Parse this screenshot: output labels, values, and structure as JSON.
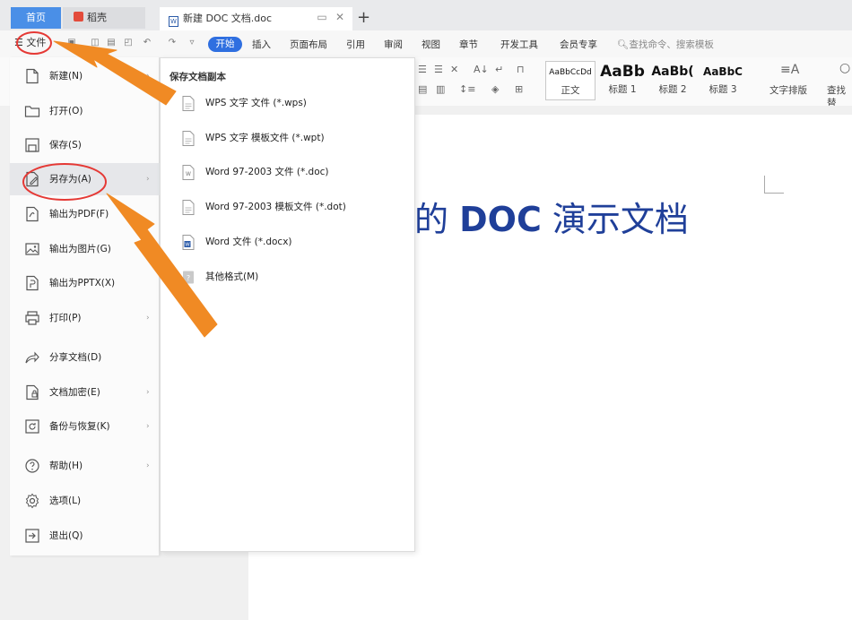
{
  "tabs": {
    "home": "首页",
    "docer": "稻壳",
    "document": "新建 DOC 文档.doc"
  },
  "ribbon": {
    "file_menu": "文件",
    "tabs": [
      "开始",
      "插入",
      "页面布局",
      "引用",
      "审阅",
      "视图",
      "章节",
      "开发工具",
      "会员专享"
    ],
    "search_placeholder": "查找命令、搜索模板"
  },
  "styles": {
    "previews": [
      "AaBbCcDd",
      "AaBb",
      "AaBb(",
      "AaBbC"
    ],
    "names": [
      "正文",
      "标题 1",
      "标题 2",
      "标题 3"
    ],
    "text_layout": "文字排版",
    "find_partial": "查找替"
  },
  "document": {
    "title_part1": "的 ",
    "title_bold": "DOC",
    "title_part2": " 演示文档"
  },
  "file_menu": {
    "items": [
      {
        "label": "新建(N)",
        "icon": "new-file-icon",
        "has_submenu": true
      },
      {
        "label": "打开(O)",
        "icon": "folder-open-icon",
        "has_submenu": false
      },
      {
        "label": "保存(S)",
        "icon": "save-icon",
        "has_submenu": false
      },
      {
        "label": "另存为(A)",
        "icon": "save-as-icon",
        "has_submenu": true
      },
      {
        "label": "输出为PDF(F)",
        "icon": "export-pdf-icon",
        "has_submenu": false
      },
      {
        "label": "输出为图片(G)",
        "icon": "export-image-icon",
        "has_submenu": false
      },
      {
        "label": "输出为PPTX(X)",
        "icon": "export-pptx-icon",
        "has_submenu": false
      },
      {
        "label": "打印(P)",
        "icon": "print-icon",
        "has_submenu": true
      },
      {
        "label": "分享文档(D)",
        "icon": "share-icon",
        "has_submenu": false
      },
      {
        "label": "文档加密(E)",
        "icon": "encrypt-icon",
        "has_submenu": true
      },
      {
        "label": "备份与恢复(K)",
        "icon": "backup-icon",
        "has_submenu": true
      },
      {
        "label": "帮助(H)",
        "icon": "help-icon",
        "has_submenu": true
      },
      {
        "label": "选项(L)",
        "icon": "options-gear-icon",
        "has_submenu": false
      },
      {
        "label": "退出(Q)",
        "icon": "exit-icon",
        "has_submenu": false
      }
    ],
    "active_index": 3
  },
  "save_as_submenu": {
    "header": "保存文档副本",
    "items": [
      {
        "label": "WPS 文字 文件 (*.wps)",
        "icon": "wps-file-icon"
      },
      {
        "label": "WPS 文字 模板文件 (*.wpt)",
        "icon": "wps-template-icon"
      },
      {
        "label": "Word 97-2003 文件 (*.doc)",
        "icon": "word-doc-icon"
      },
      {
        "label": "Word 97-2003 模板文件 (*.dot)",
        "icon": "word-template-icon"
      },
      {
        "label": "Word 文件 (*.docx)",
        "icon": "word-docx-icon"
      },
      {
        "label": "其他格式(M)",
        "icon": "other-format-icon"
      }
    ]
  },
  "colors": {
    "accent": "#2f6fe0",
    "annotation_red": "#e53935",
    "arrow_orange": "#f08a24",
    "title_blue": "#1f3f99"
  }
}
